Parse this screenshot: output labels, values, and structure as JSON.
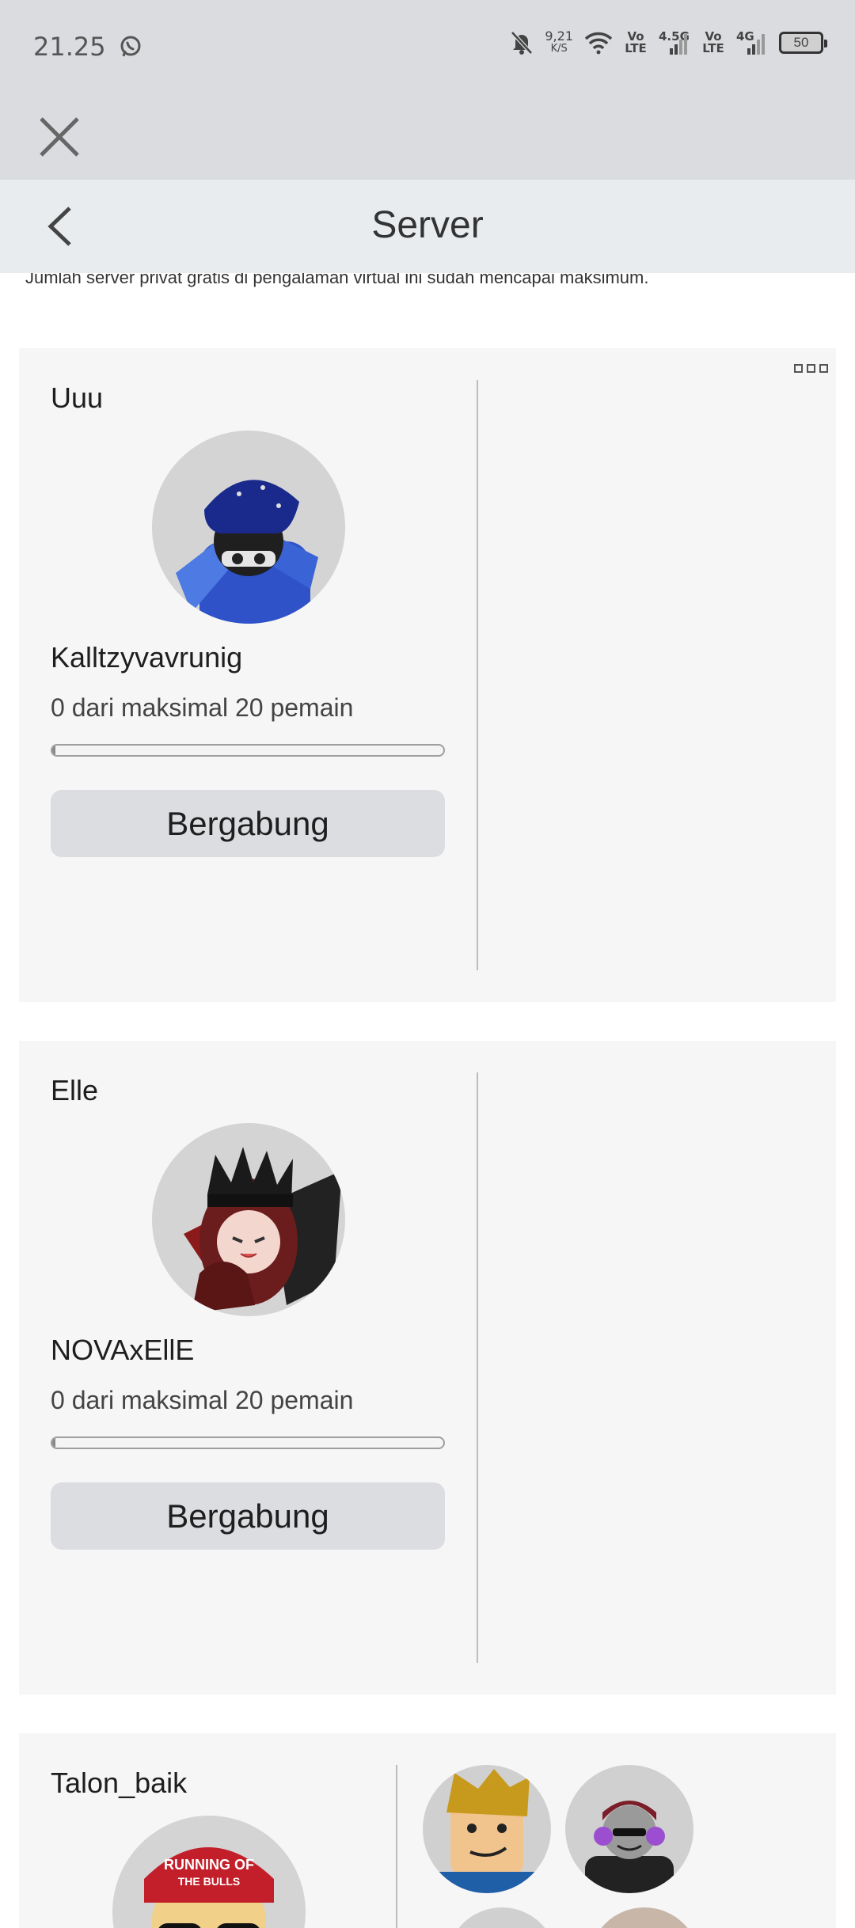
{
  "status_bar": {
    "time": "21.25",
    "net_speed_value": "9,21",
    "net_speed_unit": "K/S",
    "sim1_label": "Vo LTE",
    "sim1_network": "4.5G",
    "sim2_label": "Vo LTE",
    "sim2_network": "4G",
    "battery": "50",
    "icons": [
      "whatsapp-icon",
      "mute-bell-icon",
      "wifi-icon",
      "signal-icon",
      "battery-icon"
    ]
  },
  "header": {
    "title": "Server",
    "back_icon": "chevron-left-icon",
    "close_icon": "close-icon"
  },
  "notice": "Jumlah server privat gratis di pengalaman virtual ini sudah mencapai maksimum.",
  "servers": [
    {
      "name": "Uuu",
      "owner": "Kalltzyvavrunig",
      "capacity_text": "0 dari maksimal 20 pemain",
      "fill_fraction": 0.0,
      "join_label": "Bergabung"
    },
    {
      "name": "Elle",
      "owner": "NOVAxEllE",
      "capacity_text": "0 dari maksimal 20 pemain",
      "fill_fraction": 0.0,
      "join_label": "Bergabung"
    },
    {
      "name": "Talon_baik"
    }
  ],
  "colors": {
    "status_bg": "#dadcdf",
    "header_bg": "#e9ecef",
    "card_bg": "#f6f6f6",
    "button_bg": "#dcdde1"
  }
}
